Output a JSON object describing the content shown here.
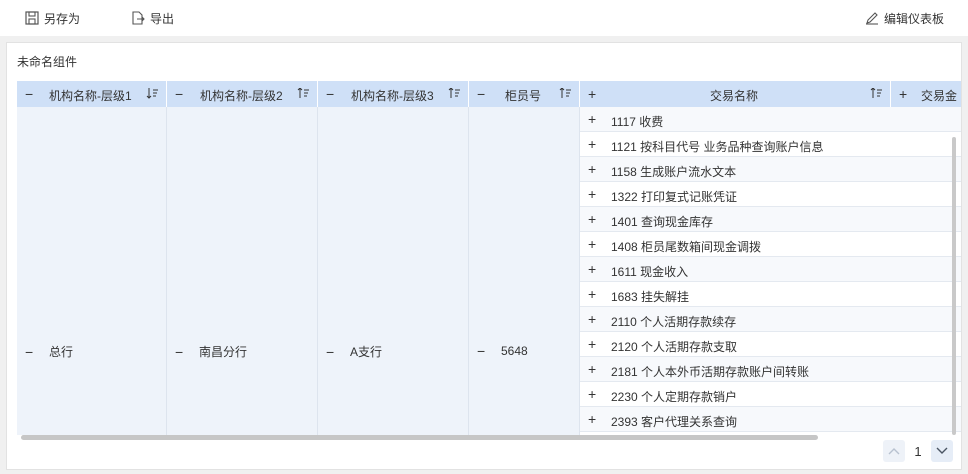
{
  "toolbar": {
    "save_as": "另存为",
    "export": "导出",
    "edit_dashboard": "编辑仪表板"
  },
  "widget": {
    "title": "未命名组件"
  },
  "table": {
    "columns": [
      {
        "label": "机构名称-层级1",
        "toggle": "−",
        "sort": "sort-desc-icon"
      },
      {
        "label": "机构名称-层级2",
        "toggle": "−",
        "sort": "sort-asc-icon"
      },
      {
        "label": "机构名称-层级3",
        "toggle": "−",
        "sort": "sort-asc-icon"
      },
      {
        "label": "柜员号",
        "toggle": "−",
        "sort": "sort-asc-icon"
      },
      {
        "label": "交易名称",
        "toggle": "+",
        "sort": "sort-asc-icon"
      },
      {
        "label": "交易金",
        "toggle": "+",
        "sort": ""
      }
    ],
    "merged": {
      "level1": "总行",
      "level2": "南昌分行",
      "level3": "A支行",
      "teller": "5648"
    },
    "transactions": [
      "1117 收费",
      "1121 按科目代号 业务品种查询账户信息",
      "1158 生成账户流水文本",
      "1322 打印复式记账凭证",
      "1401 查询现金库存",
      "1408 柜员尾数箱间现金调拨",
      "1611 现金收入",
      "1683 挂失解挂",
      "2110 个人活期存款续存",
      "2120 个人活期存款支取",
      "2181 个人本外币活期存款账户间转账",
      "2230 个人定期存款销户",
      "2393 客户代理关系查询"
    ]
  },
  "pagination": {
    "current_page": "1"
  }
}
